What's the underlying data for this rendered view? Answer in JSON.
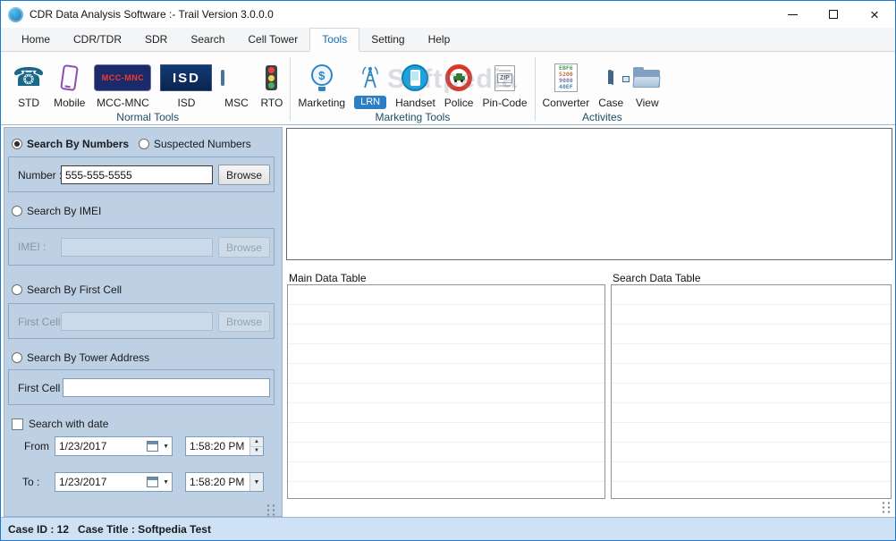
{
  "window": {
    "title": "CDR Data Analysis Software :- Trail Version 3.0.0.0"
  },
  "menu": {
    "tabs": [
      {
        "label": "Home",
        "active": false
      },
      {
        "label": "CDR/TDR",
        "active": false
      },
      {
        "label": "SDR",
        "active": false
      },
      {
        "label": "Search",
        "active": false
      },
      {
        "label": "Cell Tower",
        "active": false
      },
      {
        "label": "Tools",
        "active": true
      },
      {
        "label": "Setting",
        "active": false
      },
      {
        "label": "Help",
        "active": false
      }
    ]
  },
  "ribbon": {
    "groups": [
      {
        "label": "Normal Tools",
        "items": [
          {
            "label": "STD",
            "icon": "telephone-icon"
          },
          {
            "label": "Mobile",
            "icon": "mobile-phone-icon"
          },
          {
            "label": "MCC-MNC",
            "icon": "mcc-mnc-card-icon",
            "icon_text": "MCC-MNC"
          },
          {
            "label": "ISD",
            "icon": "isd-card-icon",
            "icon_text": "ISD"
          },
          {
            "label": "MSC",
            "icon": "monitor-icon"
          },
          {
            "label": "RTO",
            "icon": "traffic-light-icon"
          }
        ]
      },
      {
        "label": "Marketing Tools",
        "items": [
          {
            "label": "Marketing",
            "icon": "idea-bulb-icon"
          },
          {
            "label": "LRN",
            "icon": "antenna-tower-icon"
          },
          {
            "label": "Handset",
            "icon": "handset-phone-icon"
          },
          {
            "label": "Police",
            "icon": "police-car-icon"
          },
          {
            "label": "Pin-Code",
            "icon": "zip-document-icon",
            "icon_text": "ZIP"
          }
        ]
      },
      {
        "label": "Activites",
        "items": [
          {
            "label": "Converter",
            "icon": "hex-document-icon",
            "icon_rows": [
              "EBF6",
              "5200",
              "9080",
              "40EF"
            ]
          },
          {
            "label": "Case",
            "icon": "briefcase-icon"
          },
          {
            "label": "View",
            "icon": "folder-icon"
          }
        ]
      }
    ]
  },
  "search_panel": {
    "radios": {
      "numbers": "Search By Numbers",
      "suspected": "Suspected Numbers",
      "imei": "Search By IMEI",
      "first_cell": "Search By First Cell",
      "tower": "Search By Tower Address"
    },
    "number": {
      "label": "Number :",
      "value": "555-555-5555",
      "browse": "Browse"
    },
    "imei": {
      "label": "IMEI :",
      "value": "",
      "browse": "Browse"
    },
    "first_cell": {
      "label": "First Cell :",
      "value": "",
      "browse": "Browse"
    },
    "tower": {
      "label": "First Cell :",
      "value": ""
    },
    "date_filter": {
      "checkbox": "Search with date",
      "from_label": "From",
      "from_date": "1/23/2017",
      "from_time": "1:58:20 PM",
      "to_label": "To :",
      "to_date": "1/23/2017",
      "to_time": "1:58:20 PM"
    }
  },
  "main": {
    "main_table_label": "Main Data Table",
    "search_table_label": "Search Data Table",
    "watermark": "Softpedia"
  },
  "status_bar": {
    "case_id": "Case ID : 12",
    "case_title": "Case Title : Softpedia Test"
  },
  "icons": {
    "app_logo": "cdr-logo-icon",
    "telephone": "☎",
    "dollar": "$",
    "dropdown_arrow": "▼",
    "spin_up": "▲",
    "spin_down": "▼",
    "close": "×",
    "minimize": "minimize-line",
    "maximize": "maximize-square",
    "calendar": "calendar-grid"
  },
  "colors": {
    "window_border": "#1d7ad4",
    "panel_bg": "#bdd0e4",
    "statusbar_bg": "#cfe2f5",
    "active_tab_text": "#0e6eb8",
    "group_caption_text": "#1d4f63"
  }
}
